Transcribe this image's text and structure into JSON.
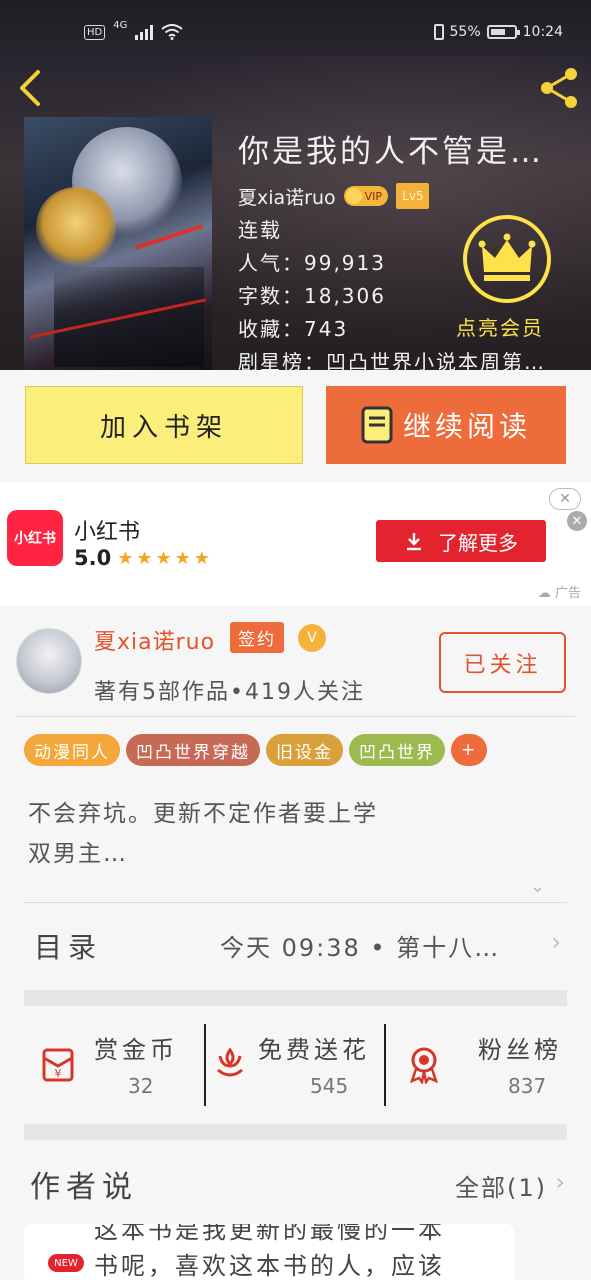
{
  "status_bar": {
    "hd": "HD",
    "network": "4G",
    "battery_percent": "55%",
    "time": "10:24"
  },
  "book": {
    "title": "你是我的人不管是…",
    "author": "夏xia诺ruo",
    "vip_label": "VIP",
    "level": "Lv5",
    "status": "连载",
    "popularity": "人气：99,913",
    "word_count": "字数：18,306",
    "favorites": "收藏：743",
    "rank": "剧星榜：凹凸世界小说本周第…"
  },
  "membership": {
    "label": "点亮会员"
  },
  "actions": {
    "add_shelf": "加入书架",
    "continue_reading": "继续阅读"
  },
  "ad": {
    "logo_text": "小红书",
    "app_name": "小红书",
    "rating": "5.0",
    "stars": "★★★★★",
    "cta": "了解更多",
    "tag": "广告"
  },
  "author_card": {
    "name": "夏xia诺ruo",
    "signed": "签约",
    "stats": "著有5部作品•419人关注",
    "follow_label": "已关注",
    "tags": [
      {
        "label": "动漫同人",
        "color": "#f4a73a"
      },
      {
        "label": "凹凸世界穿越",
        "color": "#c76a55"
      },
      {
        "label": "旧设金",
        "color": "#d9a03c"
      },
      {
        "label": "凹凸世界",
        "color": "#9bbb4f"
      },
      {
        "label": "+",
        "color": "#ee6b3c"
      }
    ],
    "description_line1": "不会弃坑。更新不定作者要上学",
    "description_line2": "双男主…"
  },
  "toc": {
    "label": "目录",
    "latest": "今天 09:38 • 第十八…"
  },
  "stats": {
    "reward": {
      "title": "赏金币",
      "value": "32"
    },
    "flowers": {
      "title": "免费送花",
      "value": "545"
    },
    "fans": {
      "title": "粉丝榜",
      "value": "837"
    }
  },
  "author_says": {
    "label": "作者说",
    "all": "全部(1)",
    "badge": "NEW",
    "line1": "这本书是我更新的最慢的一本",
    "line2": "书呢，喜欢这本书的人，应该"
  },
  "colors": {
    "accent_orange": "#ee6b3c",
    "accent_yellow": "#fbee7a",
    "brand_red": "#e2542b",
    "crown_gold": "#ffe24a"
  }
}
